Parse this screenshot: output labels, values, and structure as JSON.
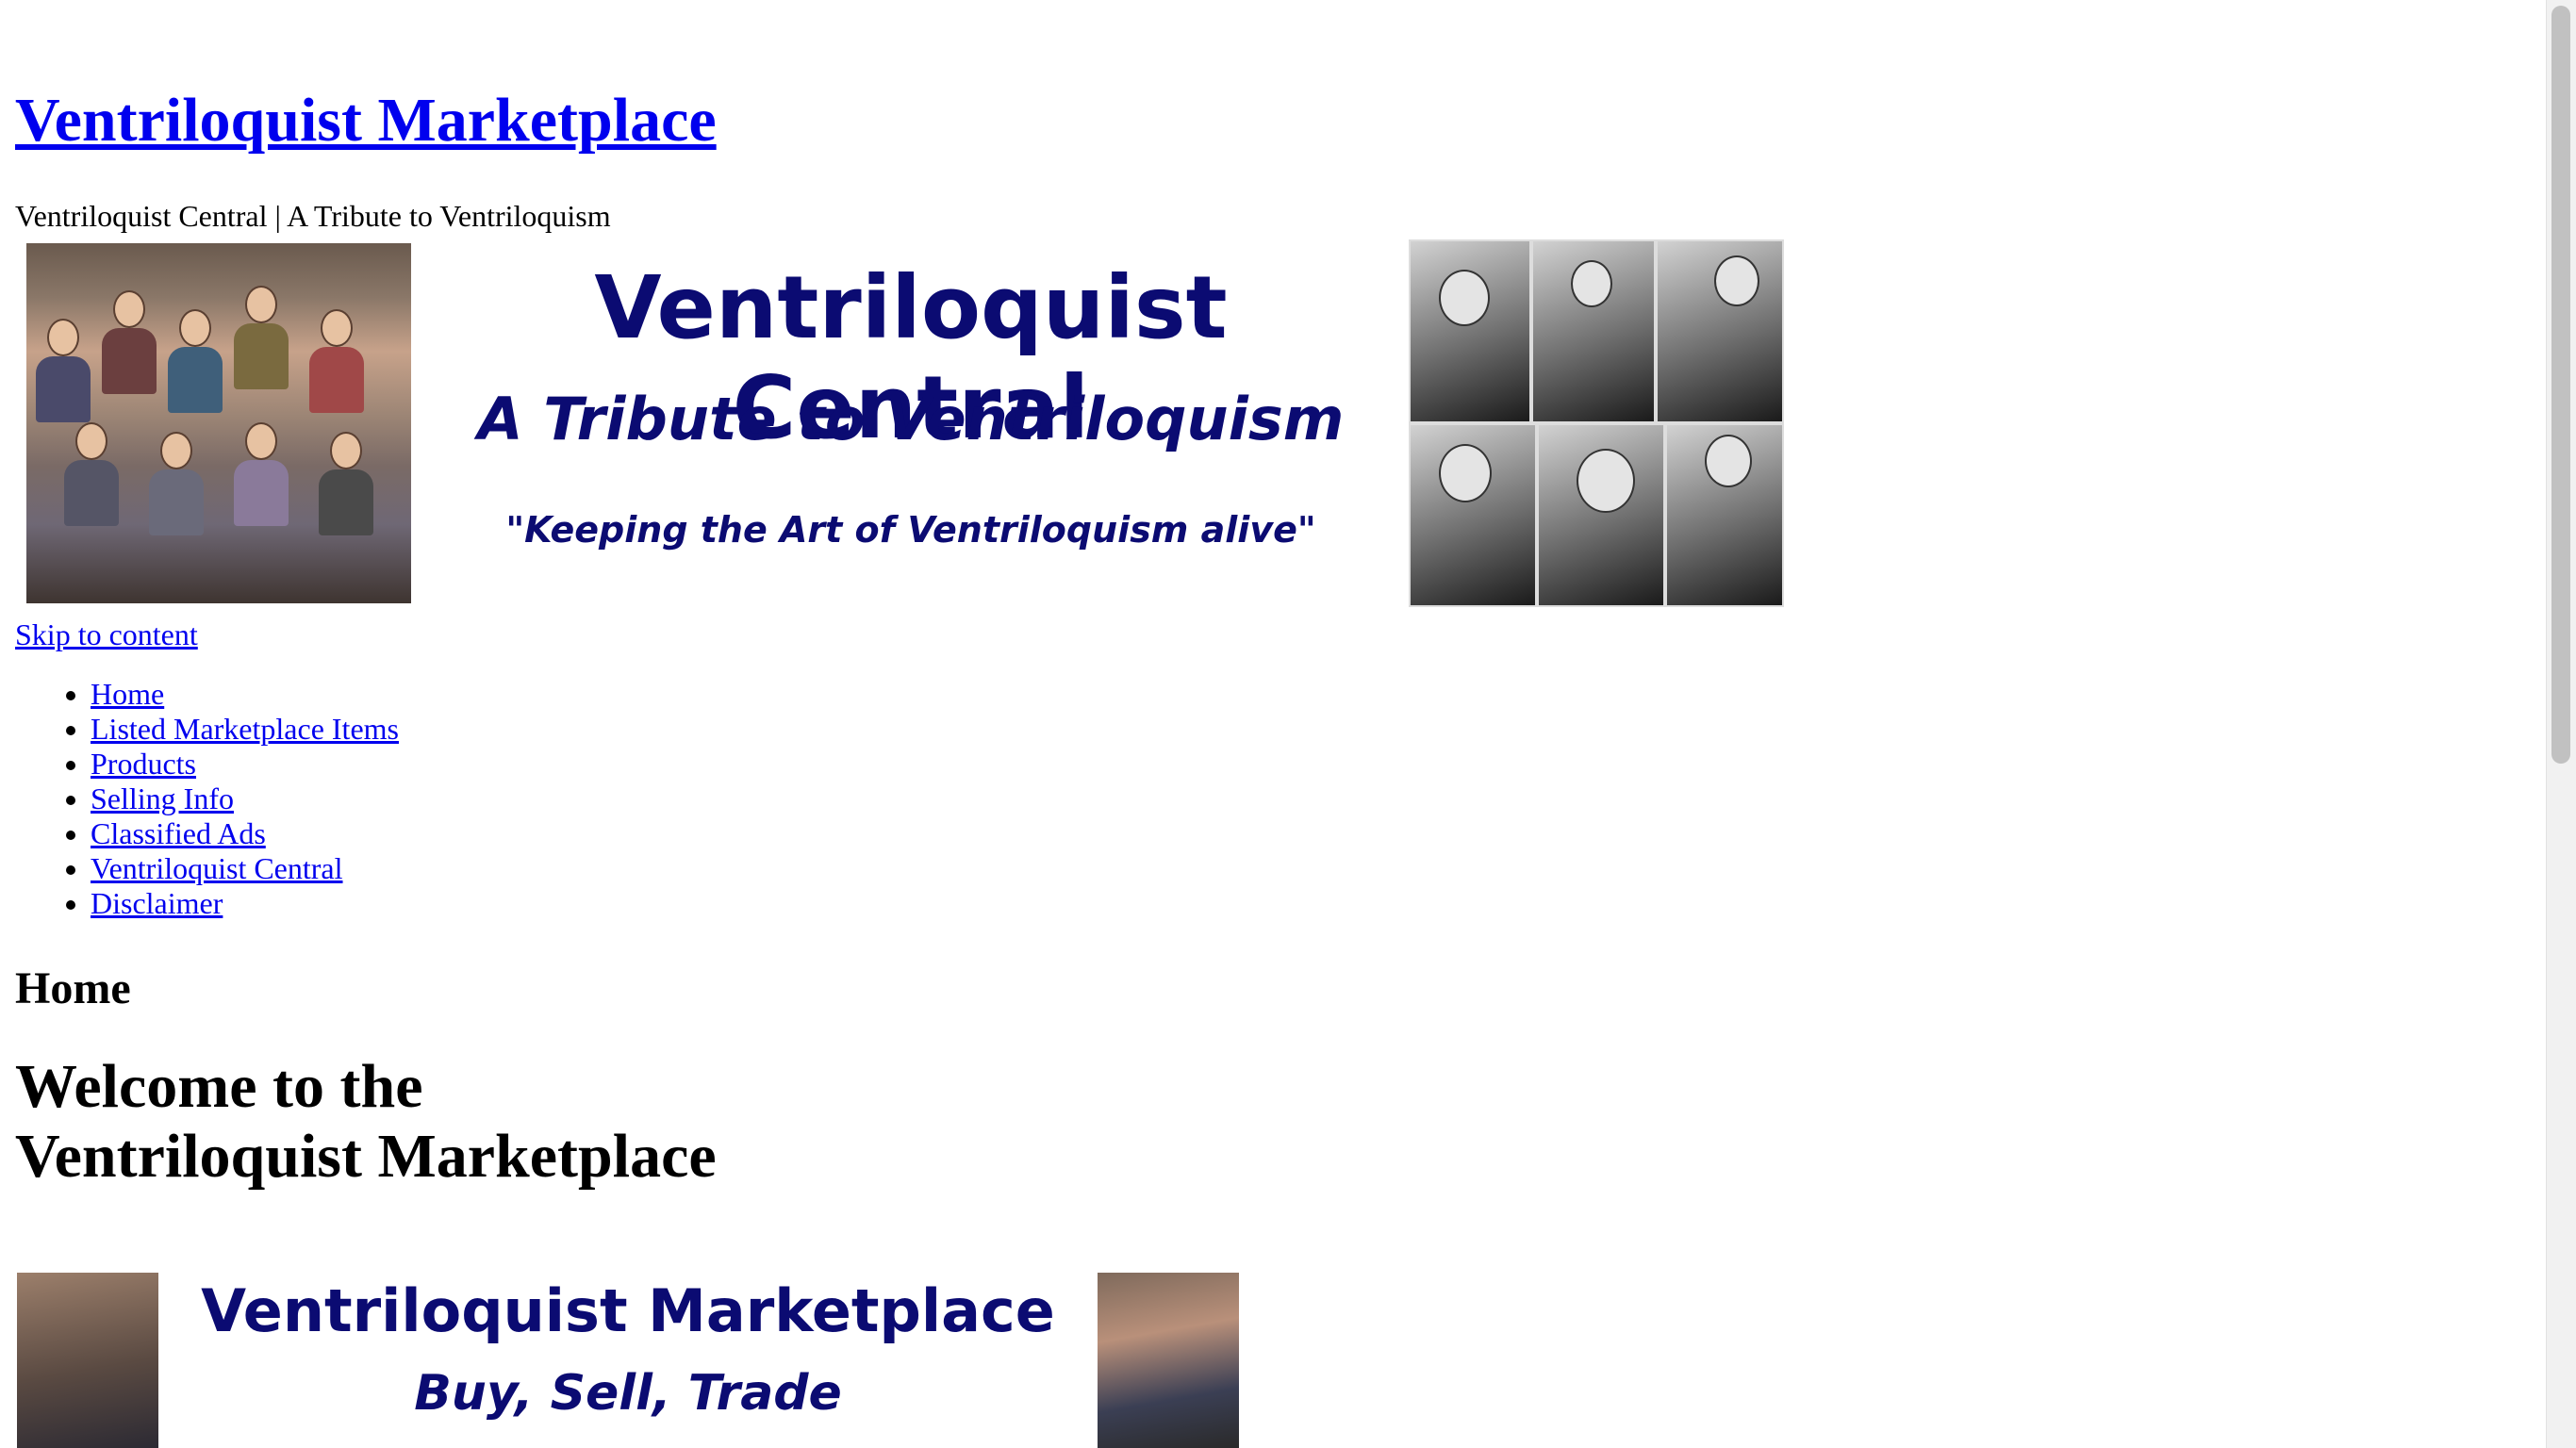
{
  "site": {
    "title": "Ventriloquist Marketplace",
    "tagline": "Ventriloquist Central | A Tribute to Ventriloquism"
  },
  "header_banner": {
    "line1": "Ventriloquist Central",
    "line2": "A Tribute to Ventriloquism",
    "line3": "\"Keeping the Art of Ventriloquism alive\""
  },
  "skip_link": "Skip to content",
  "nav": {
    "items": [
      {
        "label": "Home"
      },
      {
        "label": "Listed Marketplace Items"
      },
      {
        "label": "Products"
      },
      {
        "label": "Selling Info"
      },
      {
        "label": "Classified Ads"
      },
      {
        "label": "Ventriloquist Central"
      },
      {
        "label": "Disclaimer"
      }
    ]
  },
  "main": {
    "page_title": "Home",
    "welcome_line1": "Welcome to the",
    "welcome_line2": "Ventriloquist Marketplace",
    "banner": {
      "line1": "Ventriloquist Marketplace",
      "line2": "Buy, Sell, Trade"
    }
  },
  "colors": {
    "link": "#0000ee",
    "banner_text": "#0b0b72",
    "background": "#ffffff"
  }
}
